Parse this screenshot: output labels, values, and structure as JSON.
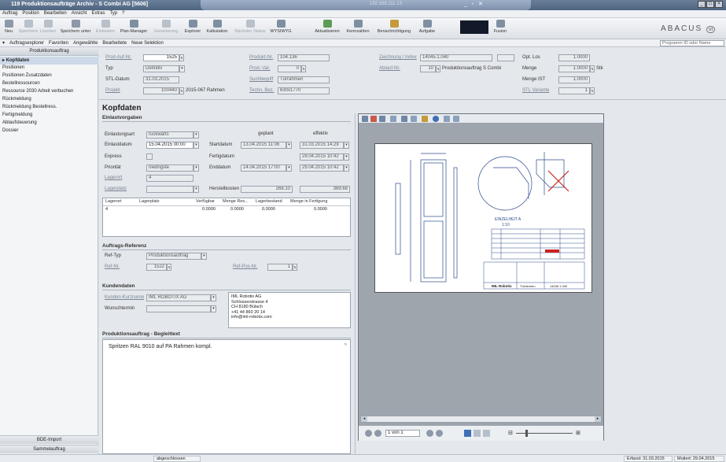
{
  "window": {
    "title": "119 Produktionsaufträge Archiv - S Combi AG [5606]",
    "remote_ip": "192.168.111.13",
    "controls": [
      "_",
      "□",
      "×"
    ]
  },
  "menu": [
    "Auftrag",
    "Position",
    "Bearbeiten",
    "Ansicht",
    "Extras",
    "Typ",
    "?"
  ],
  "toolbar": {
    "buttons": [
      {
        "label": "Neu",
        "enabled": true
      },
      {
        "label": "Speichern",
        "enabled": false
      },
      {
        "label": "Löschen",
        "enabled": false
      },
      {
        "label": "Speichern unter",
        "enabled": true
      },
      {
        "label": "Einkesten",
        "enabled": false
      },
      {
        "label": "Plan-Manager",
        "enabled": true
      },
      {
        "label": "Generierung",
        "enabled": false
      },
      {
        "label": "Explorer",
        "enabled": true
      },
      {
        "label": "Kalkulation",
        "enabled": true
      },
      {
        "label": "Nächster Status",
        "enabled": false
      },
      {
        "label": "WYSIWYG",
        "enabled": true
      },
      {
        "label": "Aktualisieren",
        "enabled": true
      },
      {
        "label": "Kennzahlen",
        "enabled": true
      },
      {
        "label": "Benachrichtigung",
        "enabled": true
      },
      {
        "label": "Aufgabe",
        "enabled": true
      },
      {
        "label": "Fusion",
        "enabled": true
      }
    ],
    "logo": "ABACUS",
    "logo_badge": "vi"
  },
  "subbar": {
    "items": [
      "Auftragsexplorer",
      "Favoriten",
      "Angewählte",
      "Bearbeitete",
      "Neue Selektion"
    ],
    "search_placeholder": "Programm ID oder Name"
  },
  "sidebar": {
    "header": "Produktionsauftrag",
    "items": [
      {
        "label": "Kopfdaten",
        "selected": true
      },
      {
        "label": "Positionen",
        "selected": false
      },
      {
        "label": "Positionen Zusatzdaten",
        "selected": false
      },
      {
        "label": "Bestellressourcen",
        "selected": false
      },
      {
        "label": "Ressource 2030 Arbeit verbuchen",
        "selected": false
      },
      {
        "label": "Rückmeldung",
        "selected": false
      },
      {
        "label": "Rückmeldung Bestellress.",
        "selected": false
      },
      {
        "label": "Fertigmeldung",
        "selected": false
      },
      {
        "label": "Ablaufsteuerung",
        "selected": false
      },
      {
        "label": "Dossier",
        "selected": false
      }
    ],
    "footer": [
      "BDE-Import",
      "Sammelauftrag"
    ]
  },
  "header_fields": {
    "prod_auf_nr": {
      "label": "Prod-Auf-Nr.",
      "value": "1525"
    },
    "typ": {
      "label": "Typ",
      "value": "Definitiv"
    },
    "stl_datum": {
      "label": "STL-Datum",
      "value": "31.03.2015"
    },
    "projekt": {
      "label": "Projekt",
      "value": "100440",
      "text": "2015-067 Rahmen"
    },
    "produkt_nr": {
      "label": "Produkt-Nr.",
      "value": "104.136"
    },
    "prod_var": {
      "label": "Prod.-Var.",
      "value": "0"
    },
    "suchbegriff": {
      "label": "Suchbegriff",
      "value": "Türrahmen"
    },
    "techn_bez": {
      "label": "Techn. Bez.",
      "value": "630x1770"
    },
    "zeichnung": {
      "label": "Zeichnung / Index",
      "value": "14045.1.040"
    },
    "ablauf_nr": {
      "label": "Ablauf-Nr.",
      "value": "10",
      "text": "Produktionsauftrag S Combi"
    },
    "opt_los": {
      "label": "Opt. Los",
      "value": "1.0000"
    },
    "menge": {
      "label": "Menge",
      "value": "1.0000",
      "unit": "Stk"
    },
    "menge_ist": {
      "label": "Menge IST",
      "value": "1.0000"
    },
    "stl_variante": {
      "label": "STL Variante",
      "value": "1"
    }
  },
  "page_title": "Kopfdaten",
  "einlastvorgaben": {
    "title": "Einlastvorgaben",
    "col_geplant": "geplant",
    "col_effektiv": "effektiv",
    "einlastungsart": {
      "label": "Einlastungsart",
      "value": "rückwärts"
    },
    "einlastdatum": {
      "label": "Einlastdatum",
      "value": "15.04.2015 00:00"
    },
    "express": {
      "label": "Express"
    },
    "prioritaet": {
      "label": "Priorität",
      "value": "niedrigste"
    },
    "lagerort": {
      "label": "Lagerort",
      "value": "4"
    },
    "lagerplatz": {
      "label": "Lagerplatz",
      "value": ""
    },
    "startdatum": {
      "label": "Startdatum",
      "geplant": "13.04.2015 11:06",
      "effektiv": "31.03.2015 14:29"
    },
    "fertigdatum": {
      "label": "Fertigdatum",
      "effektiv": "29.04.2015 10:42"
    },
    "enddatum": {
      "label": "Enddatum",
      "geplant": "14.04.2015 17:00",
      "effektiv": "29.04.2015 10:42"
    },
    "herstellkosten": {
      "label": "Herstellkosten",
      "geplant": "268.10",
      "effektiv": "369.68"
    }
  },
  "lager_table": {
    "headers": [
      "Lagerort",
      "Lagerplatz",
      "Verfügbar",
      "Menge Res...",
      "Lagerbestand",
      "Menge in Fertigung"
    ],
    "rows": [
      [
        "4",
        "",
        "0.0000",
        "0.0000",
        "0.0000",
        "0.0000"
      ]
    ]
  },
  "auftrags_referenz": {
    "title": "Auftrags-Referenz",
    "ref_typ": {
      "label": "Ref-Typ",
      "value": "Produktionsauftrag"
    },
    "ref_nr": {
      "label": "Ref-Nr.",
      "value": "1522"
    },
    "ref_pos_nr": {
      "label": "Ref-Pos-Nr.",
      "value": "1"
    }
  },
  "kundendaten": {
    "title": "Kundendaten",
    "kunden_kurzname": {
      "label": "Kunden-Kurzname",
      "value": "IML ROBOTIX AG"
    },
    "wunschtermin": {
      "label": "Wunschtermin",
      "value": ""
    },
    "address": [
      "IML Robotix AG",
      "Schlosserstrasse 4",
      "CH 8180 Bülach",
      "+41 44 860 20 14",
      "info@iml-robotix.com"
    ]
  },
  "begleittext": {
    "title": "Produktionsauftrag - Begleittext",
    "text": "Spritzen RAL 9010 auf PA Rahmen kompl."
  },
  "viewer": {
    "page_value": "1 von 1",
    "drawing_label": "EINZELHEIT A",
    "drawing_scale": "1:10",
    "titleblock_company": "IML Robotix",
    "titleblock_part": "Türrahmen",
    "titleblock_no": "14045.1.040"
  },
  "statusbar": {
    "status": "abgeschlossen",
    "erfasst": "Erfasst: 31.03.2015",
    "mutiert": "Mutiert: 29.04.2015"
  },
  "colors": {
    "accent": "#4f6480",
    "sidebar_selected": "#cdd9e8",
    "drawing_line": "#2b4a8a",
    "drawing_red": "#cc2222"
  }
}
